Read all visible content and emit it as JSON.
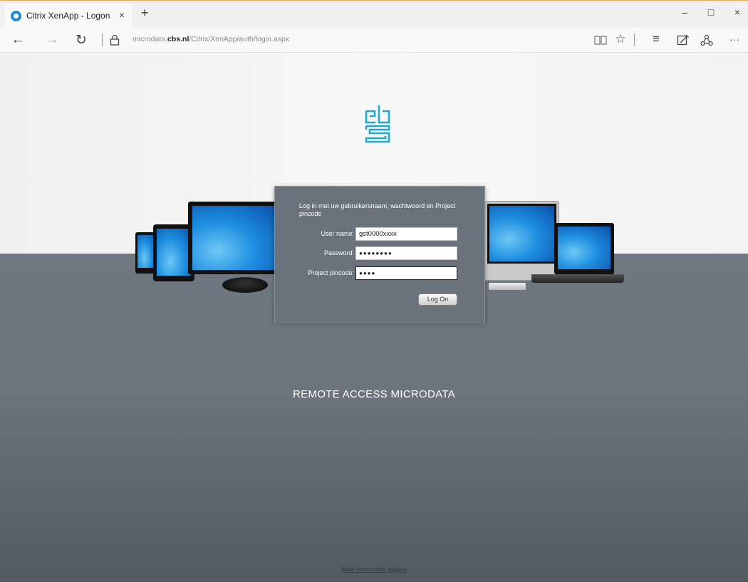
{
  "browser": {
    "tab_title": "Citrix XenApp - Logon",
    "tab_close": "×",
    "new_tab": "+",
    "win_minimize": "–",
    "win_maximize": "□",
    "win_close": "×",
    "url_prefix": "microdata.",
    "url_domain": "cbs.nl",
    "url_path": "/Citrix/XenApp/auth/login.aspx",
    "nav_back": "←",
    "nav_forward": "→",
    "nav_refresh": "↻",
    "tool_reading": "📖",
    "tool_favorite": "☆",
    "tool_hub": "≡",
    "tool_note": "✎",
    "tool_share": "♲",
    "tool_more": "···",
    "icons": [
      "tab-icon",
      "lock-icon",
      "reading-view-icon",
      "star-icon",
      "hub-icon",
      "web-note-icon",
      "share-icon",
      "more-icon"
    ]
  },
  "login": {
    "instruction": "Log in met uw gebruikersnaam, wachtwoord en Project pincode",
    "username_label": "User name:",
    "username_value": "gst0000xxxx",
    "password_label": "Password:",
    "password_value": "●●●●●●●●",
    "pincode_label": "Project pincode:",
    "pincode_value": "●●●●",
    "logon_button": "Log On"
  },
  "page": {
    "title": "REMOTE ACCESS MICRODATA",
    "info_link": "Naar informatie pagina",
    "logo_color": "#1fa8d0"
  }
}
